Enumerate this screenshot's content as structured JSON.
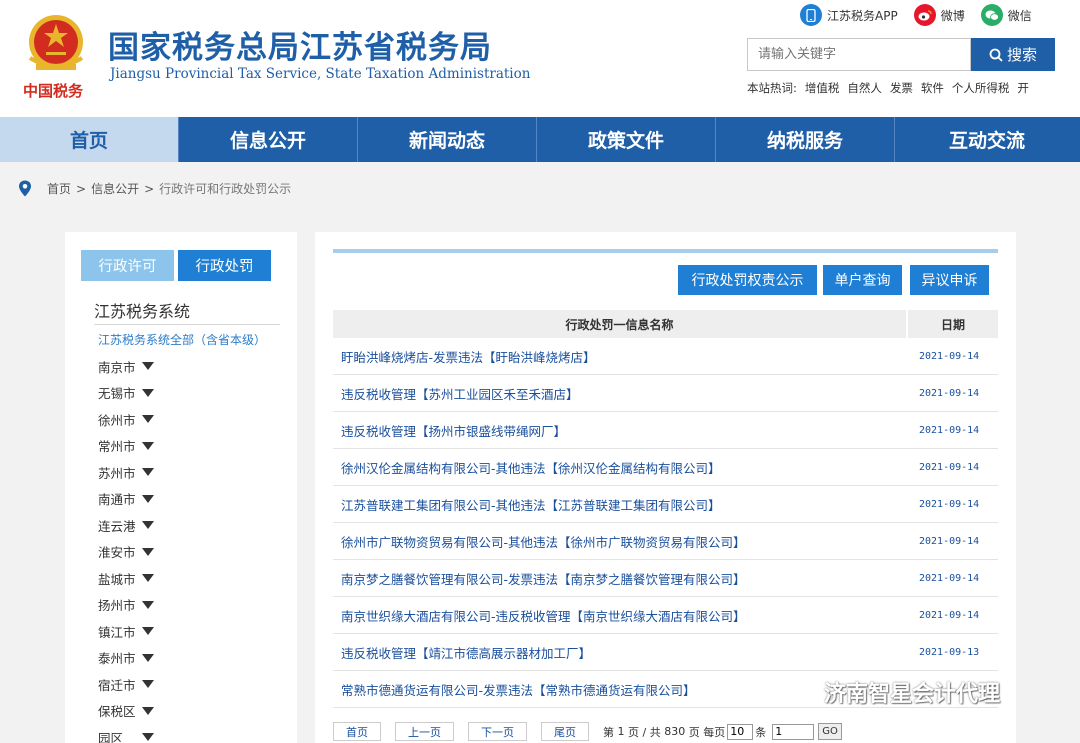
{
  "header": {
    "title_zh": "国家税务总局江苏省税务局",
    "title_en": "Jiangsu Provincial Tax Service, State Taxation Administration",
    "emblem_caption": "中国税务",
    "top_links": [
      {
        "label": "江苏税务APP",
        "icon": "mobile-app-icon",
        "color": "#1f7fd4"
      },
      {
        "label": "微博",
        "icon": "weibo-icon",
        "color": "#e6162d"
      },
      {
        "label": "微信",
        "icon": "wechat-icon",
        "color": "#2aae67"
      }
    ],
    "search": {
      "placeholder": "请输入关键字",
      "button_label": "搜索"
    },
    "hotwords_label": "本站热词:",
    "hotwords": [
      "增值税",
      "自然人",
      "发票",
      "软件",
      "个人所得税",
      "开"
    ]
  },
  "nav": {
    "items": [
      "首页",
      "信息公开",
      "新闻动态",
      "政策文件",
      "纳税服务",
      "互动交流"
    ],
    "active_index": 0
  },
  "breadcrumb": [
    "首页",
    "信息公开",
    "行政许可和行政处罚公示"
  ],
  "sidebar": {
    "tabs": [
      "行政许可",
      "行政处罚"
    ],
    "active_tab": "行政处罚",
    "heading": "江苏税务系统",
    "all_link": "江苏税务系统全部（含省本级）",
    "cities": [
      "南京市",
      "无锡市",
      "徐州市",
      "常州市",
      "苏州市",
      "南通市",
      "连云港",
      "淮安市",
      "盐城市",
      "扬州市",
      "镇江市",
      "泰州市",
      "宿迁市",
      "保税区",
      "园区"
    ]
  },
  "main": {
    "action_buttons": [
      "行政处罚权责公示",
      "单户查询",
      "异议申诉"
    ],
    "table": {
      "headers": [
        "行政处罚一信息名称",
        "日期"
      ],
      "rows": [
        {
          "name": "盱眙洪峰烧烤店-发票违法【盱眙洪峰烧烤店】",
          "date": "2021-09-14"
        },
        {
          "name": "违反税收管理【苏州工业园区禾至禾酒店】",
          "date": "2021-09-14"
        },
        {
          "name": "违反税收管理【扬州市银盛线带绳网厂】",
          "date": "2021-09-14"
        },
        {
          "name": "徐州汉伦金属结构有限公司-其他违法【徐州汉伦金属结构有限公司】",
          "date": "2021-09-14"
        },
        {
          "name": "江苏普联建工集团有限公司-其他违法【江苏普联建工集团有限公司】",
          "date": "2021-09-14"
        },
        {
          "name": "徐州市广联物资贸易有限公司-其他违法【徐州市广联物资贸易有限公司】",
          "date": "2021-09-14"
        },
        {
          "name": "南京梦之膳餐饮管理有限公司-发票违法【南京梦之膳餐饮管理有限公司】",
          "date": "2021-09-14"
        },
        {
          "name": "南京世织缘大酒店有限公司-违反税收管理【南京世织缘大酒店有限公司】",
          "date": "2021-09-14"
        },
        {
          "name": "违反税收管理【靖江市德高展示器材加工厂】",
          "date": "2021-09-13"
        },
        {
          "name": "常熟市德通货运有限公司-发票违法【常熟市德通货运有限公司】",
          "date": ""
        }
      ]
    },
    "pager": {
      "first": "首页",
      "prev": "上一页",
      "next": "下一页",
      "last": "尾页",
      "page_prefix": "第",
      "current_page": "1",
      "page_mid": "页 / 共",
      "total_pages": "830",
      "page_suffix": "页 每页",
      "per_page": "10",
      "per_page_suffix": "条",
      "goto_value": "1",
      "go_label": "GO"
    }
  },
  "watermark": {
    "text": "济南智星会计代理"
  },
  "colors": {
    "brand_blue": "#1f5fa8",
    "tab_active": "#1f7fd4",
    "tab_inactive": "#8cc4ec",
    "link": "#1a4f9c",
    "emblem_red": "#d22b1f",
    "emblem_gold": "#e8b62c"
  }
}
